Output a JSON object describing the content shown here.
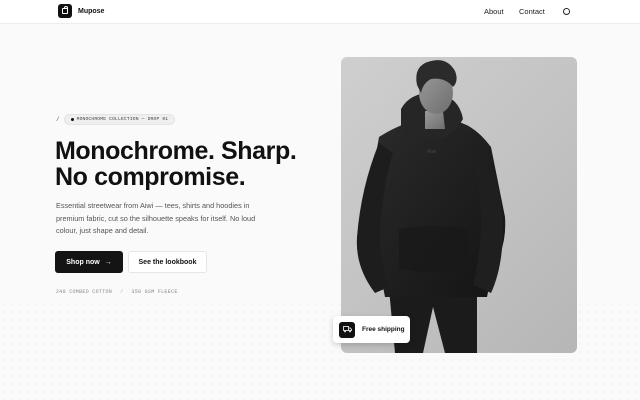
{
  "brand": {
    "name": "Mupose",
    "icon": "shopping-bag-icon"
  },
  "nav": {
    "about": "About",
    "contact": "Contact",
    "theme_icon": "moon-icon"
  },
  "hero": {
    "eyebrow_prefix": "/",
    "eyebrow": "MONOCHROME COLLECTION — DROP 01",
    "headline_line1": "Monochrome. Sharp.",
    "headline_line2": "No compromise.",
    "lede": "Essential streetwear from Aiwi — tees, shirts and hoodies in premium fabric, cut so the silhouette speaks for itself. No loud colour, just shape and detail.",
    "primary_cta": "Shop now",
    "primary_cta_icon": "arrow-right-icon",
    "secondary_cta": "See the lookbook",
    "spec_1": "240 COMBED COTTON",
    "spec_sep": "/",
    "spec_2": "350 GSM FLEECE",
    "image_alt": "Model in black hoodie and black trousers",
    "hoodie_print": "Aiwi"
  },
  "badge": {
    "label": "Free shipping",
    "icon": "truck-icon"
  },
  "colors": {
    "ink": "#111111",
    "background": "#fafafa",
    "card": "#c8c8c8"
  }
}
